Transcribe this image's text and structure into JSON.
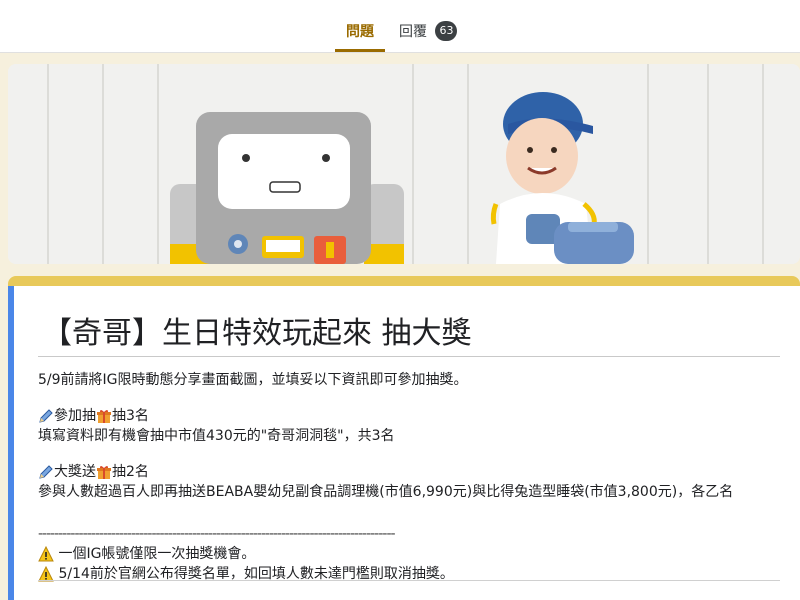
{
  "tabs": [
    {
      "label": "問題"
    },
    {
      "label": "回覆",
      "badge": "63"
    }
  ],
  "post": {
    "title": "【奇哥】生日特效玩起來 抽大獎",
    "intro": "5/9前請將IG限時動態分享畫面截圖，並填妥以下資訊即可參加抽獎。",
    "prize1": {
      "label_a": "參加抽",
      "label_b": "抽3名",
      "desc": "填寫資料即有機會抽中市值430元的\"奇哥洞洞毯\"，共3名"
    },
    "prize2": {
      "label_a": "大獎送",
      "label_b": "抽2名",
      "desc": "參與人數超過百人即再抽送BEABA嬰幼兒副食品調理機(市值6,990元)與比得兔造型睡袋(市值3,800元)，各乙名"
    },
    "divider": "----------------------------------------------------------------------------------------",
    "notes": [
      "一個IG帳號僅限一次抽獎機會。",
      "5/14前於官網公布得獎名單，如回填人數未達門檻則取消抽獎。"
    ]
  },
  "icons": {
    "pencil": "pencil-icon",
    "gift": "gift-icon",
    "warning": "warning-icon"
  },
  "colors": {
    "accent": "#9a6b00",
    "card_border": "#4a86e8",
    "header_strip": "#e8c95a",
    "background": "#f6f0dd"
  }
}
